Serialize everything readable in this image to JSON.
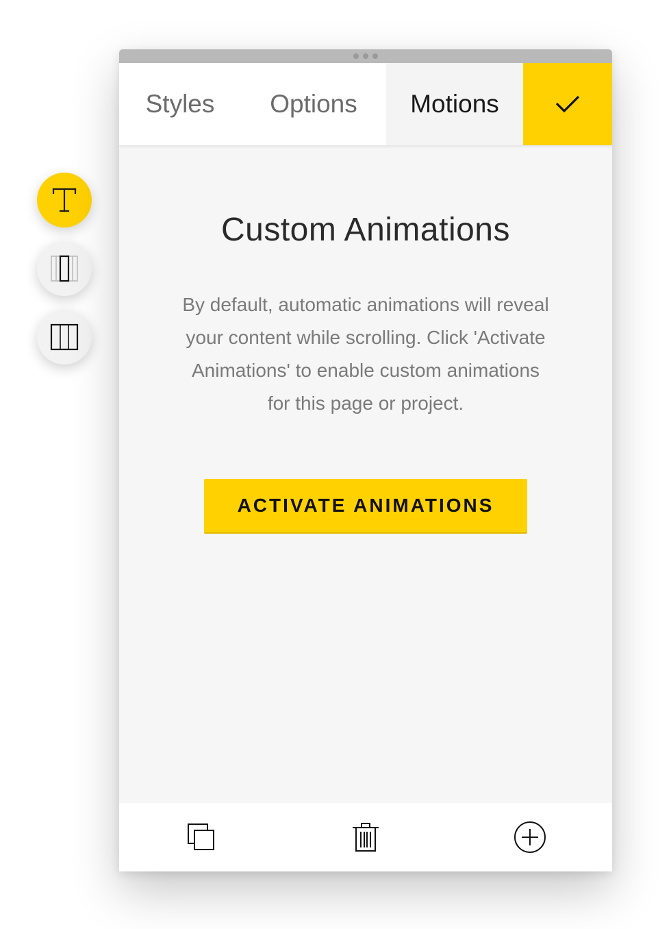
{
  "tool_rail": {
    "items": [
      {
        "icon": "text-icon",
        "active": true
      },
      {
        "icon": "single-column-icon",
        "active": false
      },
      {
        "icon": "columns-icon",
        "active": false
      }
    ]
  },
  "panel": {
    "tabs": [
      {
        "label": "Styles"
      },
      {
        "label": "Options"
      },
      {
        "label": "Motions",
        "selected": true
      }
    ],
    "confirm_icon": "check-icon",
    "heading": "Custom Animations",
    "description": "By default, automatic animations will reveal your content while scrolling. Click 'Activate Animations' to enable custom animations for this page or project.",
    "cta_label": "ACTIVATE ANIMATIONS",
    "bottom_actions": [
      {
        "icon": "duplicate-icon"
      },
      {
        "icon": "trash-icon"
      },
      {
        "icon": "add-circle-icon"
      }
    ]
  },
  "colors": {
    "accent": "#ffd100",
    "panel_bg": "#f6f6f6",
    "text_muted": "#7a7a7a"
  }
}
